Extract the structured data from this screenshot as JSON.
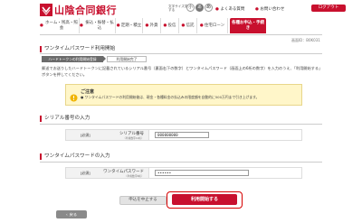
{
  "header": {
    "bank_name": "山陰合同銀行",
    "fontsize_label": "文字サイズ変更する",
    "fontsize_buttons": [
      "小",
      "あ",
      "あ"
    ],
    "help_link": "よくある質問",
    "help_link2": "お問い合わせ",
    "logout_label": "ログアウト"
  },
  "nav": {
    "items": [
      {
        "label": "ホーム・残高・照会"
      },
      {
        "label": "振込・振替・払込"
      },
      {
        "label": "定期・積立"
      },
      {
        "label": "外貨"
      },
      {
        "label": "投信"
      },
      {
        "label": "信託"
      },
      {
        "label": "住宅ローン"
      }
    ],
    "cta_label": "各種お申込・手続き"
  },
  "page": {
    "screen_id": "画面ID：B0K031",
    "title": "ワンタイムパスワード利用開始",
    "steps": {
      "current": "ハードトークンの利用開始登録",
      "next": "利用開始完了"
    },
    "description": "郵送でお送りしたハードトークンに記載されているシリアル番号（裏面右下の数字）とワンタイムパスワード（画面上の6桁の数字）を入力のうえ、「利用開始する」ボタンを押してください。",
    "notice": {
      "title": "ご注意",
      "body": "ワンタイムパスワードの利用開始後は、現金・各種料金の払込みの限度額を自動的に500万円まで引き上げます。"
    }
  },
  "serial_section": {
    "title": "シリアル番号の入力",
    "required_label": "[必須]",
    "field_label": "シリアル番号",
    "field_sublabel": "（半角数字12桁）",
    "value": "000000000"
  },
  "otp_section": {
    "title": "ワンタイムパスワードの入力",
    "required_label": "[必須]",
    "field_label": "ワンタイムパスワード",
    "field_sublabel": "（半角数字6桁）",
    "value": "••••••"
  },
  "actions": {
    "cancel_label": "申込を中止する",
    "start_label": "利用開始する",
    "back_label": "戻る"
  },
  "colors": {
    "brand": "#c8102e",
    "notice_bg": "#fff6c9",
    "highlight_ring": "#d60000"
  },
  "icons": {
    "logo": "bank-logo-icon",
    "notice": "warning-icon",
    "back": "chevron-left-icon"
  }
}
